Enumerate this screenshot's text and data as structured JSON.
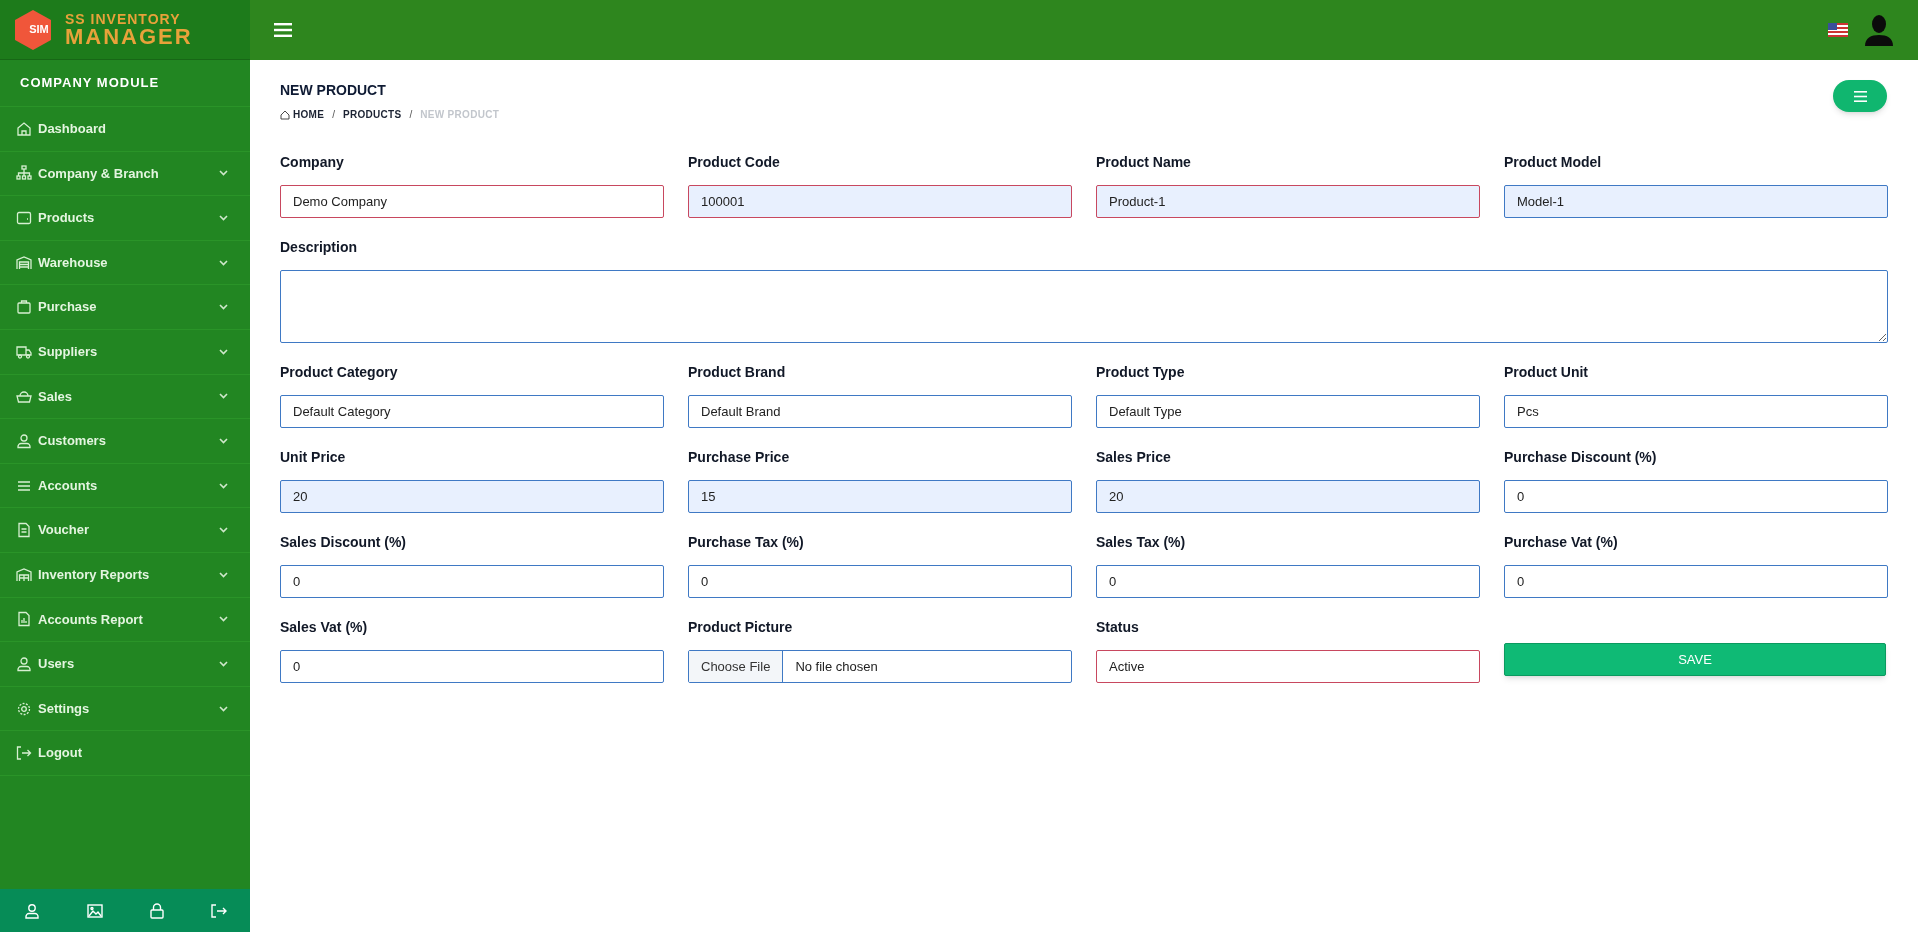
{
  "logo": {
    "badge": "SIM",
    "line_1": "SS INVENTORY",
    "line_2": "MANAGER"
  },
  "sidebar": {
    "title": "COMPANY MODULE",
    "items": [
      {
        "label": "Dashboard",
        "expandable": false
      },
      {
        "label": "Company & Branch",
        "expandable": true
      },
      {
        "label": "Products",
        "expandable": true
      },
      {
        "label": "Warehouse",
        "expandable": true
      },
      {
        "label": "Purchase",
        "expandable": true
      },
      {
        "label": "Suppliers",
        "expandable": true
      },
      {
        "label": "Sales",
        "expandable": true
      },
      {
        "label": "Customers",
        "expandable": true
      },
      {
        "label": "Accounts",
        "expandable": true
      },
      {
        "label": "Voucher",
        "expandable": true
      },
      {
        "label": "Inventory Reports",
        "expandable": true
      },
      {
        "label": "Accounts Report",
        "expandable": true
      },
      {
        "label": "Users",
        "expandable": true
      },
      {
        "label": "Settings",
        "expandable": true
      },
      {
        "label": "Logout",
        "expandable": false
      }
    ]
  },
  "page": {
    "title": "NEW PRODUCT",
    "breadcrumb_separators": [
      "/",
      "/"
    ],
    "breadcrumb": [
      {
        "label": "HOME",
        "current": false
      },
      {
        "label": "PRODUCTS",
        "current": false
      },
      {
        "label": "NEW PRODUCT",
        "current": true
      }
    ]
  },
  "form": {
    "fields": [
      {
        "kind": "text",
        "label": "Company",
        "value": "Demo Company",
        "required": true,
        "readonly": false
      },
      {
        "kind": "text",
        "label": "Product Code",
        "value": "100001",
        "required": true,
        "readonly": true
      },
      {
        "kind": "text",
        "label": "Product Name",
        "value": "Product-1",
        "required": true,
        "readonly": true
      },
      {
        "kind": "text",
        "label": "Product Model",
        "value": "Model-1",
        "required": false,
        "readonly": true
      },
      {
        "kind": "textarea",
        "label": "Description",
        "required": false,
        "readonly": false
      },
      {
        "kind": "text",
        "label": "Product Category",
        "value": "Default Category",
        "required": false,
        "readonly": false
      },
      {
        "kind": "text",
        "label": "Product Brand",
        "value": "Default Brand",
        "required": false,
        "readonly": false
      },
      {
        "kind": "text",
        "label": "Product Type",
        "value": "Default Type",
        "required": false,
        "readonly": false
      },
      {
        "kind": "text",
        "label": "Product Unit",
        "value": "Pcs",
        "required": false,
        "readonly": false
      },
      {
        "kind": "text",
        "label": "Unit Price",
        "value": "20",
        "required": false,
        "readonly": true
      },
      {
        "kind": "text",
        "label": "Purchase Price",
        "value": "15",
        "required": false,
        "readonly": true
      },
      {
        "kind": "text",
        "label": "Sales Price",
        "value": "20",
        "required": false,
        "readonly": true
      },
      {
        "kind": "text",
        "label": "Purchase Discount (%)",
        "value": "0",
        "required": false,
        "readonly": false
      },
      {
        "kind": "text",
        "label": "Sales Discount (%)",
        "value": "0",
        "required": false,
        "readonly": false
      },
      {
        "kind": "text",
        "label": "Purchase Tax (%)",
        "value": "0",
        "required": false,
        "readonly": false
      },
      {
        "kind": "text",
        "label": "Sales Tax (%)",
        "value": "0",
        "required": false,
        "readonly": false
      },
      {
        "kind": "text",
        "label": "Purchase Vat (%)",
        "value": "0",
        "required": false,
        "readonly": false
      },
      {
        "kind": "text",
        "label": "Sales Vat (%)",
        "value": "0",
        "required": false,
        "readonly": false
      },
      {
        "kind": "file",
        "label": "Product Picture",
        "button": "Choose File",
        "value": "No file chosen",
        "required": false,
        "readonly": false
      },
      {
        "kind": "text",
        "label": "Status",
        "value": "Active",
        "required": true,
        "readonly": false
      },
      {
        "kind": "button",
        "text": "SAVE"
      }
    ]
  }
}
